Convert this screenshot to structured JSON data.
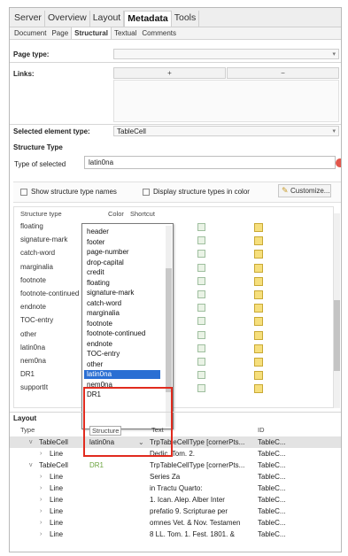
{
  "top_tabs": [
    "Server",
    "Overview",
    "Layout",
    "Metadata",
    "Tools"
  ],
  "active_top_tab": "Metadata",
  "sub_tabs": [
    "Document",
    "Page",
    "Structural",
    "Textual",
    "Comments"
  ],
  "active_sub_tab": "Structural",
  "page_type_label": "Page type:",
  "links_label": "Links:",
  "links_buttons": [
    "+",
    "−"
  ],
  "selected_element": {
    "label": "Selected element type:",
    "value": "TableCell"
  },
  "structure_type": {
    "header": "Structure Type",
    "type_label": "Type of selected",
    "type_value": "latin0na"
  },
  "options": {
    "show_names": "Show structure type names",
    "display_colors": "Display structure types in color",
    "customize": "Customize..."
  },
  "table": {
    "columns": [
      "Structure type",
      "Color",
      "Shortcut"
    ],
    "rows": [
      "floating",
      "signature-mark",
      "catch-word",
      "marginalia",
      "footnote",
      "footnote-continued",
      "endnote",
      "TOC-entry",
      "other",
      "latin0na",
      "nem0na",
      "DR1",
      "supportIt"
    ]
  },
  "dropdown": {
    "items": [
      "header",
      "footer",
      "page-number",
      "drop-capital",
      "credit",
      "floating",
      "signature-mark",
      "catch-word",
      "marginalia",
      "footnote",
      "footnote-continued",
      "endnote",
      "TOC-entry",
      "other",
      "latin0na",
      "nem0na",
      "DR1"
    ],
    "selected": "latin0na"
  },
  "layout": {
    "header": "Layout",
    "columns": [
      "Type",
      "Structure",
      "Text",
      "ID"
    ],
    "rows": [
      {
        "indent": 1,
        "expander": "v",
        "type": "TableCell",
        "structure": "latin0na",
        "structure_dropdown": true,
        "text": "TrpTableCellType [cornerPts...",
        "id": "TableC..."
      },
      {
        "indent": 2,
        "expander": "›",
        "type": "Line",
        "structure": "",
        "text": "Dedic. Tom. 2.",
        "id": "TableC..."
      },
      {
        "indent": 1,
        "expander": "v",
        "type": "TableCell",
        "structure": "DR1",
        "text": "TrpTableCellType [cornerPts...",
        "id": "TableC..."
      },
      {
        "indent": 2,
        "expander": "›",
        "type": "Line",
        "structure": "",
        "text": "Series Za",
        "id": "TableC..."
      },
      {
        "indent": 2,
        "expander": "›",
        "type": "Line",
        "structure": "",
        "text": "in Tractu Quarto:",
        "id": "TableC..."
      },
      {
        "indent": 2,
        "expander": "›",
        "type": "Line",
        "structure": "",
        "text": "1. Ican. Alep. Alber Inter",
        "id": "TableC..."
      },
      {
        "indent": 2,
        "expander": "›",
        "type": "Line",
        "structure": "",
        "text": "prefatio 9. Scripturae per",
        "id": "TableC..."
      },
      {
        "indent": 2,
        "expander": "›",
        "type": "Line",
        "structure": "",
        "text": "omnes Vet. & Nov. Testamen",
        "id": "TableC..."
      },
      {
        "indent": 2,
        "expander": "›",
        "type": "Line",
        "structure": "",
        "text": "8 LL. Tom. 1. Fest. 1801. &",
        "id": "TableC..."
      }
    ]
  }
}
